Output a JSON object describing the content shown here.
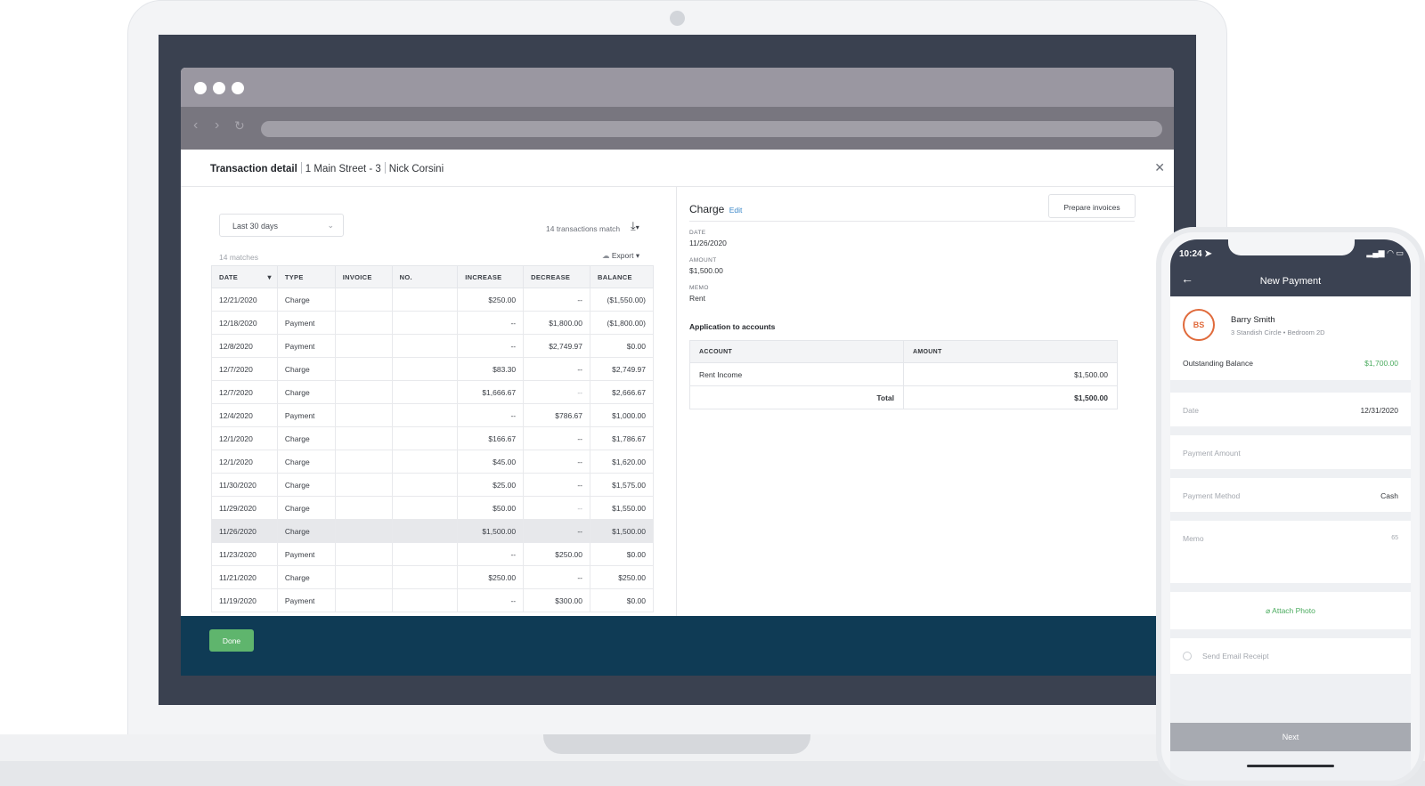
{
  "app": {
    "title": "Transaction detail",
    "property": "1 Main Street - 3",
    "tenant": "Nick Corsini"
  },
  "ledger": {
    "filter": "Last 30 days",
    "transactions_match": "14 transactions match",
    "matches": "14 matches",
    "export_label": "Export",
    "columns": [
      "DATE",
      "TYPE",
      "INVOICE",
      "NO.",
      "INCREASE",
      "DECREASE",
      "BALANCE"
    ],
    "rows": [
      {
        "date": "12/21/2020",
        "type": "Charge",
        "invoice": "",
        "no": "",
        "increase": "$250.00",
        "decrease": "--",
        "balance": "($1,550.00)"
      },
      {
        "date": "12/18/2020",
        "type": "Payment",
        "invoice": "",
        "no": "",
        "increase": "--",
        "decrease": "$1,800.00",
        "balance": "($1,800.00)"
      },
      {
        "date": "12/8/2020",
        "type": "Payment",
        "invoice": "",
        "no": "",
        "increase": "--",
        "decrease": "$2,749.97",
        "balance": "$0.00"
      },
      {
        "date": "12/7/2020",
        "type": "Charge",
        "invoice": "",
        "no": "",
        "increase": "$83.30",
        "decrease": "--",
        "balance": "$2,749.97"
      },
      {
        "date": "12/7/2020",
        "type": "Charge",
        "invoice": "",
        "no": "",
        "increase": "$1,666.67",
        "decrease": "--",
        "balance": "$2,666.67"
      },
      {
        "date": "12/4/2020",
        "type": "Payment",
        "invoice": "",
        "no": "",
        "increase": "--",
        "decrease": "$786.67",
        "balance": "$1,000.00"
      },
      {
        "date": "12/1/2020",
        "type": "Charge",
        "invoice": "",
        "no": "",
        "increase": "$166.67",
        "decrease": "--",
        "balance": "$1,786.67"
      },
      {
        "date": "12/1/2020",
        "type": "Charge",
        "invoice": "",
        "no": "",
        "increase": "$45.00",
        "decrease": "--",
        "balance": "$1,620.00"
      },
      {
        "date": "11/30/2020",
        "type": "Charge",
        "invoice": "",
        "no": "",
        "increase": "$25.00",
        "decrease": "--",
        "balance": "$1,575.00"
      },
      {
        "date": "11/29/2020",
        "type": "Charge",
        "invoice": "",
        "no": "",
        "increase": "$50.00",
        "decrease": "--",
        "balance": "$1,550.00"
      },
      {
        "date": "11/26/2020",
        "type": "Charge",
        "invoice": "",
        "no": "",
        "increase": "$1,500.00",
        "decrease": "--",
        "balance": "$1,500.00",
        "selected": true
      },
      {
        "date": "11/23/2020",
        "type": "Payment",
        "invoice": "",
        "no": "",
        "increase": "--",
        "decrease": "$250.00",
        "balance": "$0.00"
      },
      {
        "date": "11/21/2020",
        "type": "Charge",
        "invoice": "",
        "no": "",
        "increase": "$250.00",
        "decrease": "--",
        "balance": "$250.00"
      },
      {
        "date": "11/19/2020",
        "type": "Payment",
        "invoice": "",
        "no": "",
        "increase": "--",
        "decrease": "$300.00",
        "balance": "$0.00"
      }
    ]
  },
  "detail": {
    "title": "Charge",
    "edit_label": "Edit",
    "prepare_label": "Prepare invoices",
    "date_label": "DATE",
    "date": "11/26/2020",
    "amount_label": "AMOUNT",
    "amount": "$1,500.00",
    "memo_label": "MEMO",
    "memo": "Rent",
    "application_label": "Application to accounts",
    "acct_columns": [
      "ACCOUNT",
      "AMOUNT"
    ],
    "acct_rows": [
      {
        "account": "Rent Income",
        "amount": "$1,500.00"
      }
    ],
    "total_label": "Total",
    "total": "$1,500.00"
  },
  "footer": {
    "done_label": "Done"
  },
  "phone": {
    "time": "10:24",
    "title": "New Payment",
    "initials": "BS",
    "name": "Barry Smith",
    "address": "3 Standish Circle • Bedroom 2D",
    "balance_label": "Outstanding Balance",
    "balance": "$1,700.00",
    "date_label": "Date",
    "date": "12/31/2020",
    "amount_label": "Payment Amount",
    "method_label": "Payment Method",
    "method": "Cash",
    "memo_label": "Memo",
    "memo_count": "65",
    "attach_label": "Attach Photo",
    "receipt_label": "Send Email Receipt",
    "next_label": "Next"
  },
  "colors": {
    "accent": "#3a87c8",
    "done": "#5fb56d",
    "footer": "#0f3b55",
    "phone_header": "#3b4252",
    "avatar": "#e06a3b",
    "balance": "#4aab5e"
  }
}
